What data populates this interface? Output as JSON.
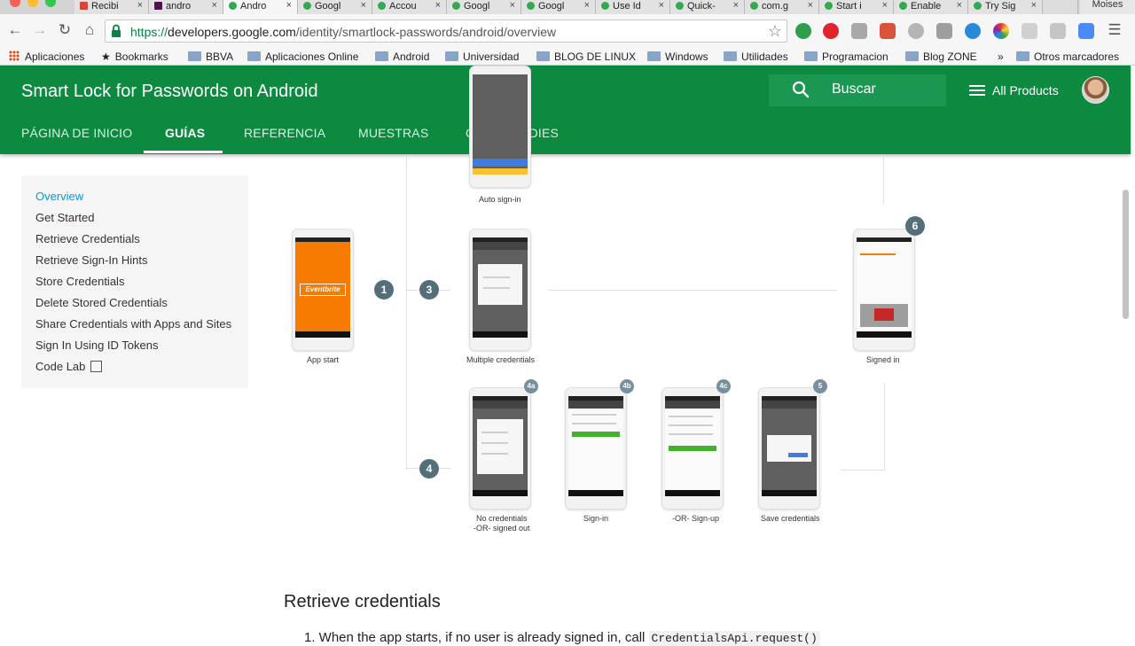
{
  "browser": {
    "tabs": [
      {
        "label": "Recibi",
        "favicon_color": "#d44638"
      },
      {
        "label": "andro",
        "favicon_color": "#4a154b"
      },
      {
        "label": "Andro",
        "favicon_color": "#34a853"
      },
      {
        "label": "Googl",
        "favicon_color": "#34a853"
      },
      {
        "label": "Accou",
        "favicon_color": "#34a853"
      },
      {
        "label": "Googl",
        "favicon_color": "#34a853"
      },
      {
        "label": "Googl",
        "favicon_color": "#34a853"
      },
      {
        "label": "Use Id",
        "favicon_color": "#34a853"
      },
      {
        "label": "Quick-",
        "favicon_color": "#34a853"
      },
      {
        "label": "com.g",
        "favicon_color": "#34a853"
      },
      {
        "label": "Start i",
        "favicon_color": "#34a853"
      },
      {
        "label": "Enable",
        "favicon_color": "#34a853"
      },
      {
        "label": "Try Sig",
        "favicon_color": "#34a853"
      }
    ],
    "close_glyph": "×",
    "profile_name": "Moises",
    "url": {
      "scheme": "https://",
      "host": "developers.google.com",
      "path": "/identity/smartlock-passwords/android/overview"
    },
    "nav": {
      "back": "←",
      "forward": "→",
      "reload": "↻",
      "home": "⌂",
      "star": "☆",
      "menu": "☰"
    },
    "bookmarks": [
      {
        "label": "Aplicaciones",
        "icon": "apps-grid-icon"
      },
      {
        "label": "Bookmarks",
        "icon": "star-icon"
      },
      {
        "label": "BBVA",
        "icon": "folder-icon"
      },
      {
        "label": "Aplicaciones Online",
        "icon": "folder-icon"
      },
      {
        "label": "Android",
        "icon": "folder-icon"
      },
      {
        "label": "Universidad",
        "icon": "folder-icon"
      },
      {
        "label": "BLOG DE LINUX",
        "icon": "folder-icon"
      },
      {
        "label": "Windows",
        "icon": "folder-icon"
      },
      {
        "label": "Utilidades",
        "icon": "folder-icon"
      },
      {
        "label": "Programacion",
        "icon": "folder-icon"
      },
      {
        "label": "Blog ZONE",
        "icon": "folder-icon"
      }
    ],
    "bookmarks_overflow": "»",
    "other_bookmarks": "Otros marcadores"
  },
  "site": {
    "title": "Smart Lock for Passwords on Android",
    "search_placeholder": "Buscar",
    "all_products": "All Products",
    "tabs": [
      "PÁGINA DE INICIO",
      "GUÍAS",
      "REFERENCIA",
      "MUESTRAS",
      "CASE STUDIES"
    ],
    "accent": "#0c8a3f"
  },
  "sidebar": {
    "items": [
      "Overview",
      "Get Started",
      "Retrieve Credentials",
      "Retrieve Sign-In Hints",
      "Store Credentials",
      "Delete Stored Credentials",
      "Share Credentials with Apps and Sites",
      "Sign In Using ID Tokens",
      "Code Lab"
    ],
    "active_color": "#039be5"
  },
  "diagram": {
    "brand": "Eventbrite",
    "captions": {
      "auto": "Auto sign-in",
      "app_start": "App start",
      "multiple": "Multiple credentials",
      "signed_in": "Signed in",
      "none_line1": "No credentials",
      "none_line2": "-OR- signed out",
      "sign_in": "Sign-in",
      "sign_up": "-OR- Sign-up",
      "save": "Save credentials"
    },
    "badges": {
      "b1": "1",
      "b3": "3",
      "b4": "4",
      "b6": "6",
      "b4a": "4a",
      "b4b": "4b",
      "b4c": "4c",
      "b5": "5"
    }
  },
  "content": {
    "section_title": "Retrieve credentials",
    "cut_text": "1.  When the app starts, if no user is already signed in, call",
    "cut_code": "CredentialsApi.request()"
  }
}
